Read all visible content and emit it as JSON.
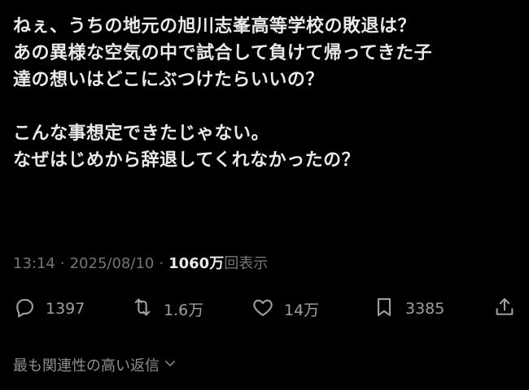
{
  "tweet": {
    "lines": [
      "ねぇ、うちの地元の旭川志峯高等学校の敗退は？",
      "あの異様な空気の中で試合して負けて帰ってきた子",
      "達の想いはどこにぶつけたらいいの？",
      "",
      "こんな事想定できたじゃない。",
      "なぜはじめから辞退してくれなかったの？"
    ]
  },
  "meta": {
    "time": "13:14",
    "separator": "·",
    "date": "2025/08/10",
    "views_count": "1060万",
    "views_label": "回表示"
  },
  "actions": {
    "replies": "1397",
    "reposts": "1.6万",
    "likes": "14万",
    "bookmarks": "3385"
  },
  "icons": {
    "reply": "reply-icon",
    "repost": "repost-icon",
    "like": "heart-icon",
    "bookmark": "bookmark-icon",
    "share": "share-icon",
    "chevron": "chevron-down-icon"
  },
  "replies_sort": {
    "label": "最も関連性の高い返信"
  },
  "colors": {
    "background": "#000000",
    "text": "#e7e9ea",
    "secondary": "#71767b"
  }
}
